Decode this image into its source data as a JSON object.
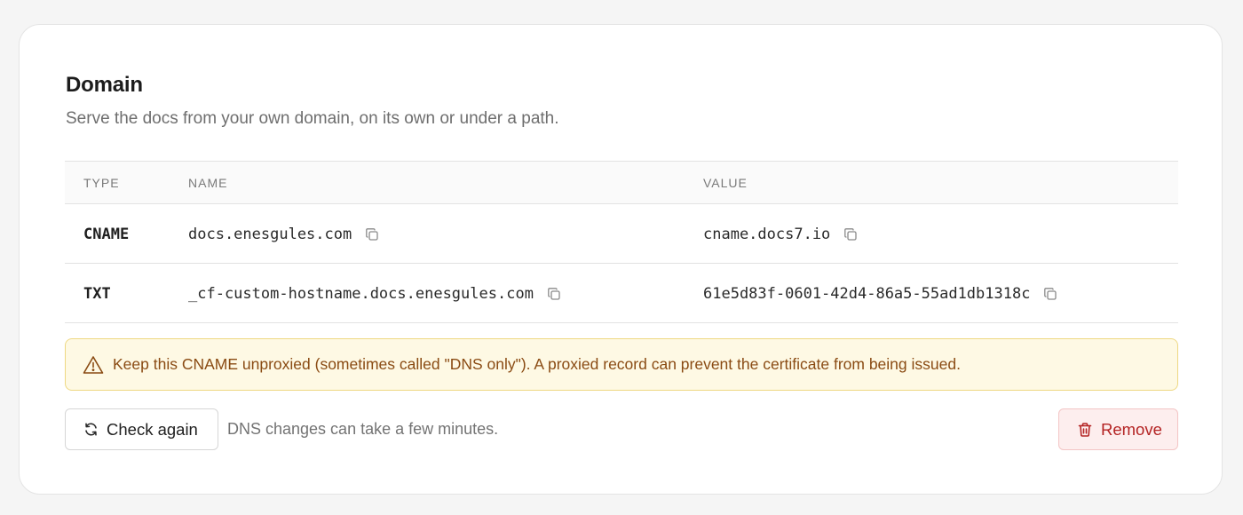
{
  "section": {
    "title": "Domain",
    "subtitle": "Serve the docs from your own domain, on its own or under a path."
  },
  "table": {
    "headers": {
      "type": "TYPE",
      "name": "NAME",
      "value": "VALUE"
    },
    "rows": [
      {
        "type": "CNAME",
        "name": "docs.enesgules.com",
        "value": "cname.docs7.io"
      },
      {
        "type": "TXT",
        "name": "_cf-custom-hostname.docs.enesgules.com",
        "value": "61e5d83f-0601-42d4-86a5-55ad1db1318c"
      }
    ],
    "copy_icon": "copy-icon"
  },
  "warning": {
    "icon": "warning-triangle-icon",
    "text": "Keep this CNAME unproxied (sometimes called \"DNS only\"). A proxied record can prevent the certificate from being issued."
  },
  "actions": {
    "check_again_label": "Check again",
    "check_again_icon": "refresh-icon",
    "hint": "DNS changes can take a few minutes.",
    "remove_label": "Remove",
    "remove_icon": "trash-icon"
  },
  "colors": {
    "warning_bg": "#fef9e4",
    "warning_border": "#eed883",
    "warning_text": "#8a4b13",
    "danger_text": "#b42323",
    "danger_bg": "#fdeeee"
  }
}
